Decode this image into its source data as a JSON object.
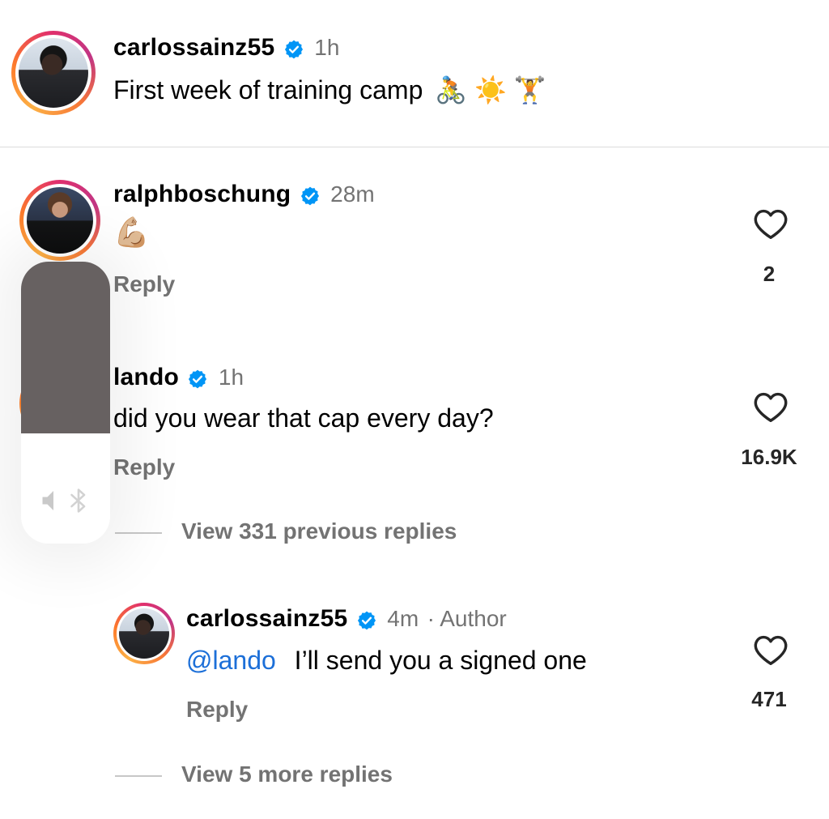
{
  "post": {
    "username": "carlossainz55",
    "time": "1h",
    "caption": "First week of training camp",
    "caption_emojis": "🚴 ☀️ 🏋️"
  },
  "comments": [
    {
      "username": "ralphboschung",
      "time": "28m",
      "text": "💪🏼",
      "reply_label": "Reply",
      "likes": "2"
    },
    {
      "username": "lando",
      "time": "1h",
      "text": "did you wear that cap every day?",
      "reply_label": "Reply",
      "likes": "16.9K",
      "view_previous": "View 331 previous replies",
      "replies": [
        {
          "username": "carlossainz55",
          "time": "4m",
          "author_tag": "· Author",
          "mention": "@lando",
          "text": "I’ll send you a signed one",
          "reply_label": "Reply",
          "likes": "471"
        }
      ],
      "view_more": "View 5 more replies"
    }
  ],
  "volume_hud": {
    "level": 0.61,
    "icons": [
      "speaker-icon",
      "bluetooth-icon"
    ]
  },
  "colors": {
    "verified": "#0095f6",
    "mention": "#1c6fd8",
    "secondary_text": "#737373"
  }
}
